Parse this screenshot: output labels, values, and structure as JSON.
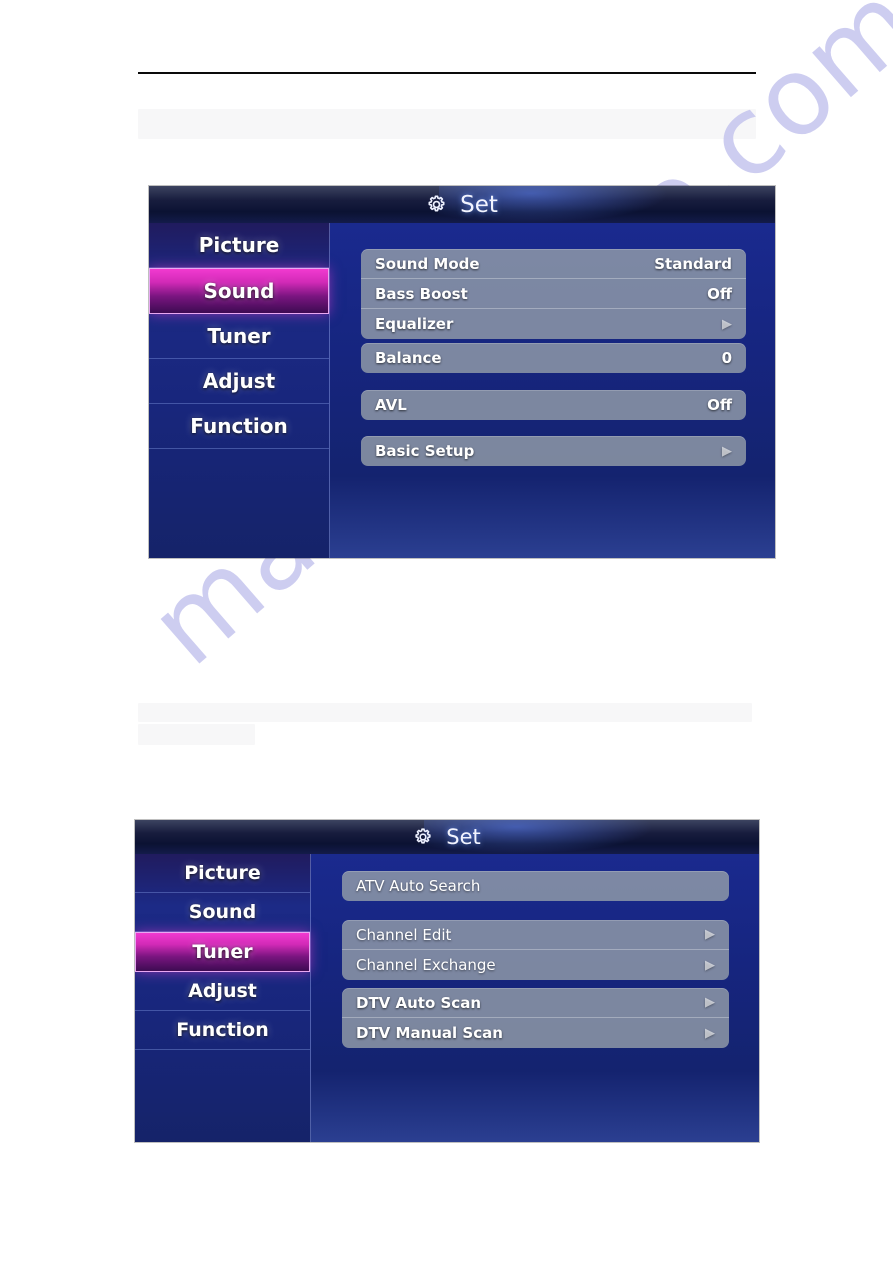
{
  "page": {
    "watermark": "manualshive.com",
    "rule_visible": true,
    "blank_bars": [
      "",
      "",
      ""
    ]
  },
  "osd_sound": {
    "title": "Set",
    "title_icon": "gear-icon",
    "sidebar": {
      "items": [
        {
          "label": "Picture",
          "active": false
        },
        {
          "label": "Sound",
          "active": true
        },
        {
          "label": "Tuner",
          "active": false
        },
        {
          "label": "Adjust",
          "active": false
        },
        {
          "label": "Function",
          "active": false
        }
      ]
    },
    "groups": [
      {
        "rows": [
          {
            "label": "Sound Mode",
            "value": "Standard",
            "arrow": false,
            "bold": true
          },
          {
            "label": "Bass Boost",
            "value": "Off",
            "arrow": false,
            "bold": true
          },
          {
            "label": "Equalizer",
            "value": "",
            "arrow": true,
            "bold": true
          }
        ]
      },
      {
        "rows": [
          {
            "label": "Balance",
            "value": "0",
            "arrow": false,
            "bold": true
          }
        ]
      },
      {
        "rows": [
          {
            "label": "AVL",
            "value": "Off",
            "arrow": false,
            "bold": true
          }
        ]
      },
      {
        "rows": [
          {
            "label": "Basic Setup",
            "value": "",
            "arrow": true,
            "bold": true
          }
        ]
      }
    ]
  },
  "osd_tuner": {
    "title": "Set",
    "title_icon": "gear-icon",
    "sidebar": {
      "items": [
        {
          "label": "Picture",
          "active": false
        },
        {
          "label": "Sound",
          "active": false
        },
        {
          "label": "Tuner",
          "active": true
        },
        {
          "label": "Adjust",
          "active": false
        },
        {
          "label": "Function",
          "active": false
        }
      ]
    },
    "groups": [
      {
        "rows": [
          {
            "label": "ATV Auto Search",
            "value": "",
            "arrow": false,
            "bold": false
          }
        ]
      },
      {
        "rows": [
          {
            "label": "Channel Edit",
            "value": "",
            "arrow": true,
            "bold": false
          },
          {
            "label": "Channel Exchange",
            "value": "",
            "arrow": true,
            "bold": false
          }
        ]
      },
      {
        "rows": [
          {
            "label": "DTV Auto Scan",
            "value": "",
            "arrow": true,
            "bold": true
          },
          {
            "label": "DTV Manual Scan",
            "value": "",
            "arrow": true,
            "bold": true
          }
        ]
      }
    ]
  },
  "colors": {
    "osd_background": "#16257f",
    "sidebar_active": "#d22ab7",
    "menu_row": "#96a0aa",
    "titlebar": "#0b1233",
    "watermark": "#c9c9ef",
    "rule": "#0a0a0a"
  }
}
